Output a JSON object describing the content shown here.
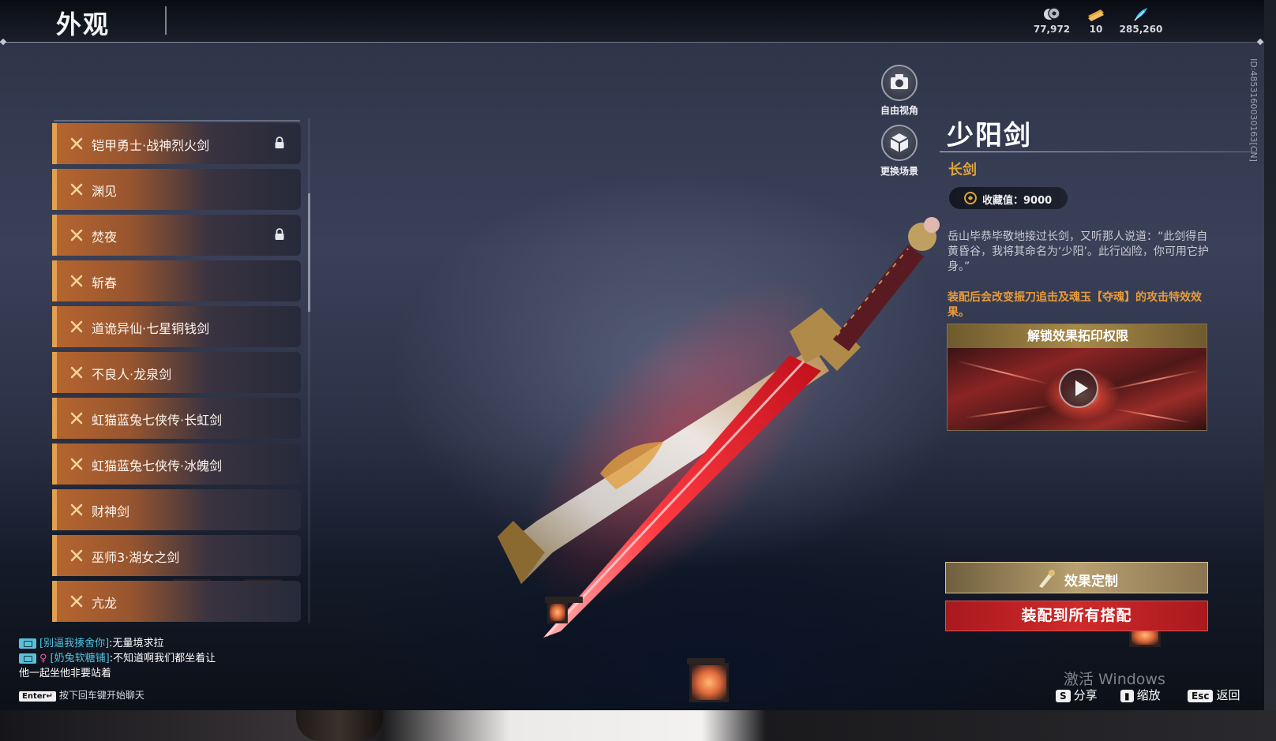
{
  "header": {
    "title": "外观",
    "currencies": [
      {
        "icon": "coin-stack-icon",
        "value": "77,972"
      },
      {
        "icon": "ticket-icon",
        "value": "10"
      },
      {
        "icon": "feather-icon",
        "value": "285,260"
      }
    ]
  },
  "list": {
    "items": [
      {
        "label": "铠甲勇士·战神烈火剑",
        "locked": true
      },
      {
        "label": "渊见",
        "locked": false
      },
      {
        "label": "焚夜",
        "locked": true
      },
      {
        "label": "斩春",
        "locked": false
      },
      {
        "label": "道诡异仙·七星铜钱剑",
        "locked": false
      },
      {
        "label": "不良人·龙泉剑",
        "locked": false
      },
      {
        "label": "虹猫蓝兔七侠传·长虹剑",
        "locked": false
      },
      {
        "label": "虹猫蓝兔七侠传·冰魄剑",
        "locked": false
      },
      {
        "label": "财神剑",
        "locked": false
      },
      {
        "label": "巫师3·湖女之剑",
        "locked": false
      },
      {
        "label": "亢龙",
        "locked": false
      }
    ]
  },
  "camera": {
    "free_view_label": "自由视角",
    "change_scene_label": "更换场景"
  },
  "detail": {
    "name": "少阳剑",
    "type": "长剑",
    "collect_value": "收藏值：9000",
    "description": "岳山毕恭毕敬地接过长剑，又听那人说道：“此剑得自黄昏谷，我将其命名为‘少阳’。此行凶险，你可用它护身。”",
    "effect_note": "装配后会改变振刀追击及魂玉【夺魂】的攻击特效效果。",
    "unlock_title": "解锁效果拓印权限",
    "custom_button": "效果定制",
    "equip_button": "装配到所有搭配",
    "id_text": "ID:4853160030163[CN]"
  },
  "chat": {
    "messages": [
      {
        "name": "[别逼我揍舍你]",
        "text": ":无量境求拉"
      },
      {
        "name": "[奶兔软糖铺]",
        "text": ":不知道啊我们都坐着让"
      },
      {
        "name": "",
        "text": "他一起坐他非要站着"
      }
    ],
    "enter_key": "Enter↵",
    "enter_hint": "按下回车键开始聊天"
  },
  "hints": {
    "watermark": "激活 Windows",
    "share_key": "S",
    "share_label": "分享",
    "zoom_label": "缩放",
    "esc_key": "Esc",
    "back_label": "返回"
  },
  "colors": {
    "accent_gold": "#e0a438",
    "equip_red": "#c8242a",
    "chat_name": "#4fc3e0",
    "list_orange": "#b5652f"
  }
}
